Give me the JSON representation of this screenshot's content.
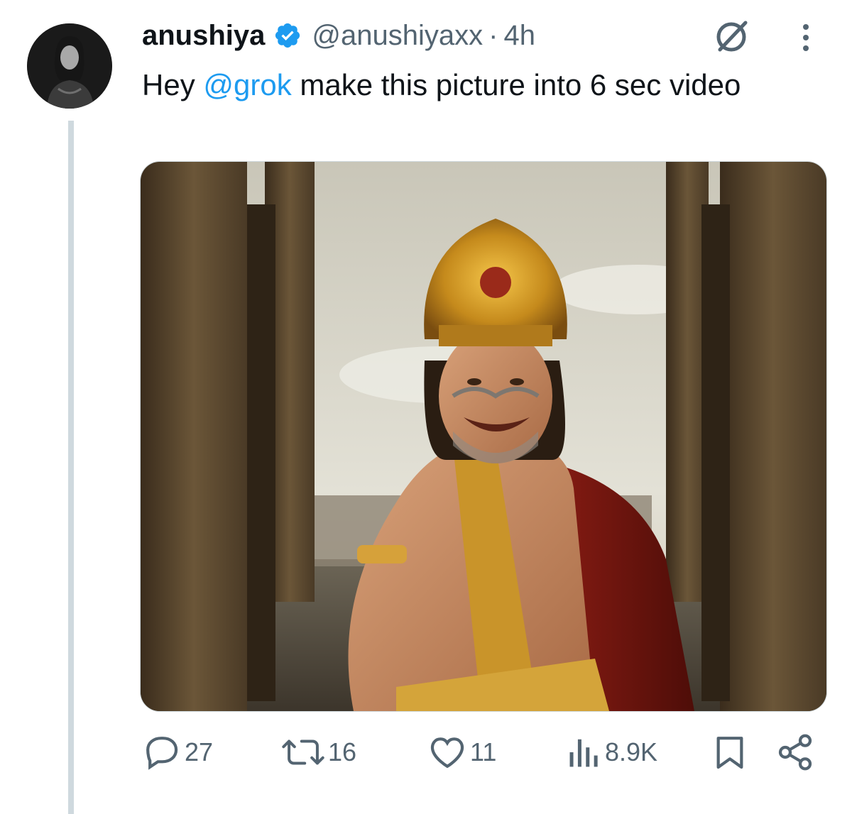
{
  "tweet": {
    "author_name": "anushiya",
    "handle": "@anushiyaxx",
    "separator": "·",
    "time": "4h",
    "text_prefix": "Hey ",
    "mention": "@grok",
    "text_suffix": " make this picture into 6 sec video"
  },
  "icons": {
    "verified": "verified-badge-icon",
    "grok": "grok-icon",
    "more": "more-vertical-icon"
  },
  "actions": {
    "replies": "27",
    "reposts": "16",
    "likes": "11",
    "views": "8.9K"
  },
  "colors": {
    "accent": "#1d9bf0",
    "text_primary": "#0f1419",
    "text_secondary": "#536471",
    "thread_line": "#cfd9de"
  }
}
